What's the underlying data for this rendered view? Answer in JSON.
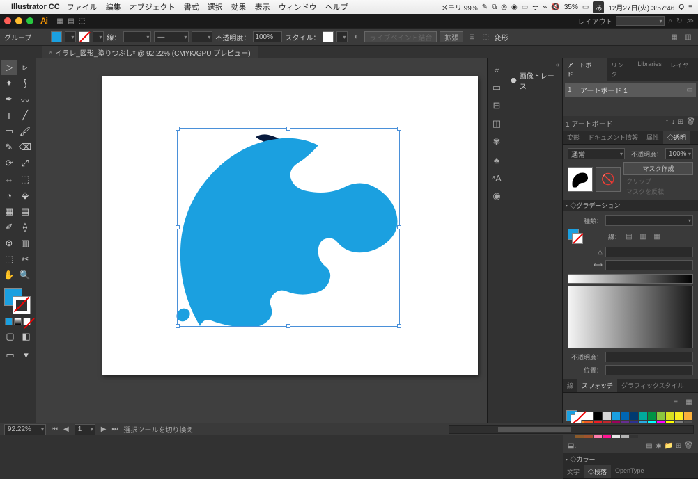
{
  "mac": {
    "app": "Illustrator CC",
    "menus": [
      "ファイル",
      "編集",
      "オブジェクト",
      "書式",
      "選択",
      "効果",
      "表示",
      "ウィンドウ",
      "ヘルプ"
    ],
    "memory": "メモリ 99%",
    "battery": "35%",
    "ime": "あ",
    "datetime": "12月27日(火) 3:57:46"
  },
  "titlebar": {
    "layout_label": "レイアウト",
    "search_icon": "⌕"
  },
  "controlbar": {
    "group": "グループ",
    "stroke_label": "線：",
    "opacity_label": "不透明度：",
    "opacity_value": "100%",
    "style_label": "スタイル：",
    "live_paint": "ライブペイント結合",
    "expand": "拡張",
    "transform": "変形"
  },
  "doctab": {
    "title": "イラレ_図形_塗りつぶし* @ 92.22% (CMYK/GPU プレビュー)"
  },
  "statusbar": {
    "zoom": "92.22%",
    "hint": "選択ツールを切り換え"
  },
  "trace": {
    "label": "画像トレース"
  },
  "panels": {
    "artboards": {
      "tabs": [
        "アートボード",
        "リンク",
        "Libraries",
        "レイヤー"
      ],
      "row_num": "1",
      "row_name": "アートボード 1",
      "footer_label": "1 アートボード"
    },
    "transparency": {
      "tabs": [
        "変形",
        "ドキュメント情報",
        "属性",
        "◇透明"
      ],
      "mode": "通常",
      "opacity_label": "不透明度：",
      "opacity_value": "100%",
      "mask_btn": "マスク作成",
      "clip": "クリップ",
      "invert": "マスクを反転"
    },
    "gradient": {
      "header": "◇グラデーション",
      "type_label": "種類：",
      "stroke_label": "線：",
      "opacity_label": "不透明度：",
      "position_label": "位置："
    },
    "swatches": {
      "tabs": [
        "線",
        "スウォッチ",
        "グラフィックスタイル"
      ],
      "colors": [
        "#ffffff",
        "#000000",
        "#d6d6d6",
        "#1ba0e0",
        "#0066b3",
        "#003a70",
        "#00a99d",
        "#009245",
        "#8cc63f",
        "#d9e021",
        "#fcee21",
        "#fbb03b",
        "#f7931e",
        "#f15a24",
        "#ed1c24",
        "#c1272d",
        "#9e005d",
        "#662d91",
        "#2e3192",
        "#29abe2",
        "#00ffff",
        "#ff00ff",
        "#ffff00",
        "#7f7f7f",
        "#4d4d4d",
        "#8b5a2b",
        "#a0522d",
        "#ff7bac",
        "#ff1493",
        "#e6e6e6",
        "#b3b3b3",
        "#333333"
      ]
    },
    "color": {
      "header": "◇カラー"
    },
    "type": {
      "tabs": [
        "文字",
        "◇段落",
        "OpenType"
      ]
    }
  }
}
